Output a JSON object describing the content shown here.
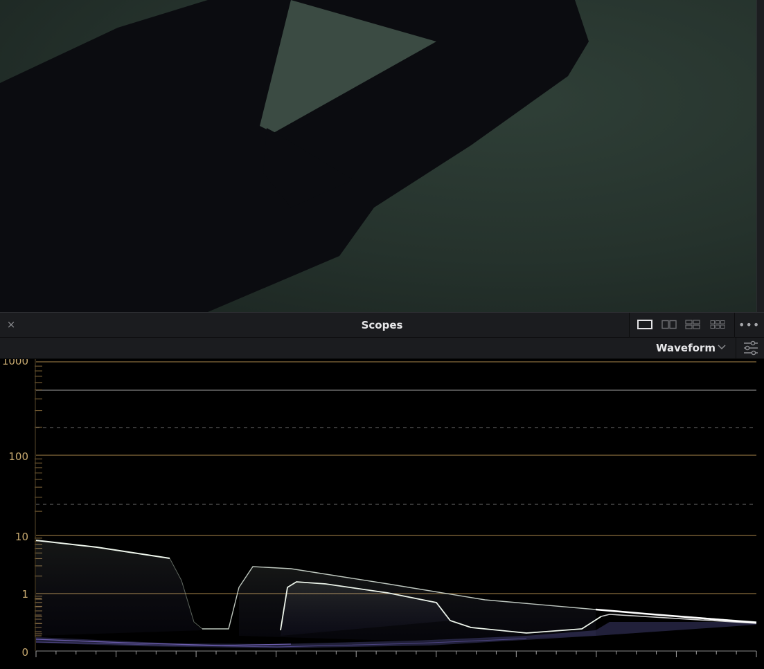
{
  "panel": {
    "title": "Scopes",
    "close_symbol": "×",
    "more_symbol": "•••"
  },
  "toolbar": {
    "scope_type": "Waveform"
  },
  "icons": {
    "close": "close-icon",
    "layout_1": "single-view-icon",
    "layout_2": "dual-view-icon",
    "layout_4": "quad-view-icon",
    "layout_6": "six-view-icon",
    "more": "more-options-icon",
    "dropdown": "chevron-down-icon",
    "settings": "sliders-settings-icon"
  },
  "colors": {
    "graticule_major": "#8a6d3c",
    "graticule_minor": "#6b6b6b",
    "label": "#c8aa70",
    "trace_bright": "#eef6ec",
    "trace_low": "#7b6bc6"
  },
  "chart_data": {
    "type": "waveform",
    "scale": "log",
    "y_tick_labels": [
      "1000",
      "100",
      "10",
      "1",
      "0"
    ],
    "solid_levels": [
      1000,
      100,
      10,
      1,
      500
    ],
    "dashed_levels": [
      200,
      25
    ],
    "x_ticks": 36
  }
}
